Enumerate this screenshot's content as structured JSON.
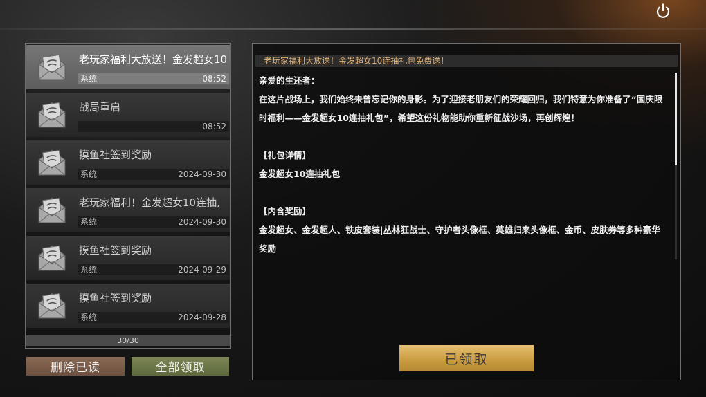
{
  "mails": [
    {
      "title": "老玩家福利大放送！金发超女10",
      "sender": "系统",
      "date": "08:52",
      "selected": true
    },
    {
      "title": "战局重启",
      "sender": "",
      "date": "08:52",
      "selected": false
    },
    {
      "title": "摸鱼社签到奖励",
      "sender": "系统",
      "date": "2024-09-30",
      "selected": false
    },
    {
      "title": "老玩家福利！金发超女10连抽,",
      "sender": "系统",
      "date": "2024-09-30",
      "selected": false
    },
    {
      "title": "摸鱼社签到奖励",
      "sender": "系统",
      "date": "2024-09-29",
      "selected": false
    },
    {
      "title": "摸鱼社签到奖励",
      "sender": "系统",
      "date": "2024-09-28",
      "selected": false
    }
  ],
  "pager": "30/30",
  "buttons": {
    "delete_read": "删除已读",
    "claim_all": "全部领取",
    "claimed": "已领取"
  },
  "detail": {
    "header": "老玩家福利大放送！金发超女10连抽礼包免费送！",
    "greeting": "亲爱的生还者：",
    "para1": "在这片战场上，我们始终未曾忘记你的身影。为了迎接老朋友们的荣耀回归，我们特意为你准备了“国庆限时福利——金发超女10连抽礼包”，希望这份礼物能助你重新征战沙场，再创辉煌！",
    "section1_title": "【礼包详情】",
    "section1_body": "金发超女10连抽礼包",
    "section2_title": "【内含奖励】",
    "section2_body": "金发超女、金发超人、铁皮套装|丛林狂战士、守护者头像框、英雄归来头像框、金币、皮肤券等多种豪华奖励"
  },
  "icons": {
    "power": "power-icon",
    "mail": "open-envelope-icon"
  },
  "colors": {
    "header_text": "#e0b27a",
    "claimed_button": "#d4ab55",
    "delete_button": "#7c5e4a",
    "claim_all_button": "#6d784a"
  }
}
